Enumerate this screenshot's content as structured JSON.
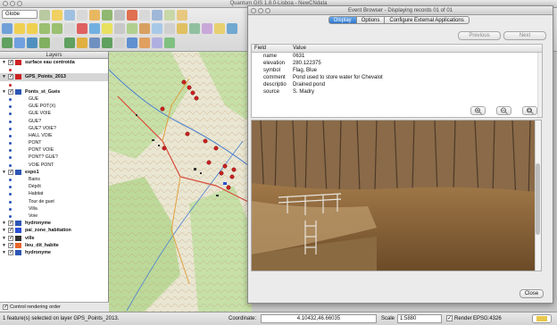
{
  "window": {
    "title": "Quantum GIS 1.8.0-Lisboa - NewCNdata"
  },
  "toolbar": {
    "combo_value": "Globe"
  },
  "layers_panel": {
    "title": "Layers",
    "layers": [
      {
        "name": "surface eau centroida",
        "checked": "✓",
        "expand": "▼",
        "icon_color": "#cc2222",
        "subitems": [
          {
            "label": "",
            "dot_color": "#cc2222"
          }
        ]
      },
      {
        "name": "GPS_Points_2013",
        "checked": "✓",
        "expand": "▼",
        "selected": true,
        "icon_color": "#cc2222",
        "subitems": [
          {
            "label": "",
            "dot_color": "#cc2222"
          }
        ]
      },
      {
        "name": "Ponts_st_Gués",
        "checked": "✓",
        "expand": "▼",
        "icon_color": "#2d56b5",
        "subitems": [
          {
            "label": "GUE"
          },
          {
            "label": "GUE POT(X)"
          },
          {
            "label": "GUE VOIE"
          },
          {
            "label": "GUE?"
          },
          {
            "label": "GUE? VOIE?"
          },
          {
            "label": "HALL VOIE"
          },
          {
            "label": "PONT"
          },
          {
            "label": "PONT VOIE"
          },
          {
            "label": "PONT? GUE?"
          },
          {
            "label": "VOIE PONT"
          }
        ]
      },
      {
        "name": "expo1",
        "checked": "✓",
        "expand": "▼",
        "icon_color": "#2d56b5",
        "subitems": [
          {
            "label": "Bains"
          },
          {
            "label": "Dépôt"
          },
          {
            "label": "Habitat"
          },
          {
            "label": "Tour de guet"
          },
          {
            "label": "Villa"
          },
          {
            "label": "Voie"
          }
        ]
      },
      {
        "name": "hydronyme",
        "checked": "✓",
        "expand": "▼",
        "icon_color": "#2d56b5",
        "subitems": []
      },
      {
        "name": "pai_zone_habitation",
        "checked": "✓",
        "expand": "▼",
        "icon_color": "#2a4fd4",
        "subitems": []
      },
      {
        "name": "ville",
        "checked": "✓",
        "expand": "▼",
        "icon_color": "#333333",
        "subitems": []
      },
      {
        "name": "lieu_dit_habite",
        "checked": "✓",
        "expand": "▼",
        "icon_color": "#e8662a",
        "subitems": []
      },
      {
        "name": "hydronyme",
        "checked": "✓",
        "expand": "▼",
        "icon_color": "#2d56b5",
        "subitems": []
      }
    ],
    "control_rendering_order": {
      "label": "Control rendering order",
      "checked": "✓"
    }
  },
  "status_bar": {
    "message": "1 feature(s) selected on layer GPS_Points_2013.",
    "coordinate_label": "Coordinate:",
    "coordinate_value": "4.10432,46.66035",
    "scale_label": "Scale",
    "scale_value": "1:5880",
    "render_label": "Render",
    "render_checked": "✓",
    "epsg_label": "EPSG:4326"
  },
  "event_browser": {
    "title": "Event Browser - Displaying records 01 of 01",
    "tabs": [
      {
        "label": "Display",
        "active": true
      },
      {
        "label": "Options"
      },
      {
        "label": "Configure External Applications"
      }
    ],
    "previous_label": "Previous",
    "next_label": "Next",
    "table": {
      "headers": {
        "field": "Field",
        "value": "Value"
      },
      "rows": [
        {
          "field": "name",
          "value": "0631"
        },
        {
          "field": "elevation",
          "value": "280.122375"
        },
        {
          "field": "symbol",
          "value": "Flag, Blue"
        },
        {
          "field": "comment",
          "value": "Pond used to store water for Chevalot"
        },
        {
          "field": "descriptio",
          "value": "Drained pond"
        },
        {
          "field": "source",
          "value": "S. Madry"
        }
      ]
    },
    "zoom_buttons": [
      {
        "icon": "zoom-in-icon"
      },
      {
        "icon": "zoom-out-icon"
      },
      {
        "icon": "zoom-fit-icon"
      }
    ],
    "close_label": "Close"
  },
  "colors": {
    "tab_active": "#2f78cf",
    "gps_point": "#cc2222"
  }
}
